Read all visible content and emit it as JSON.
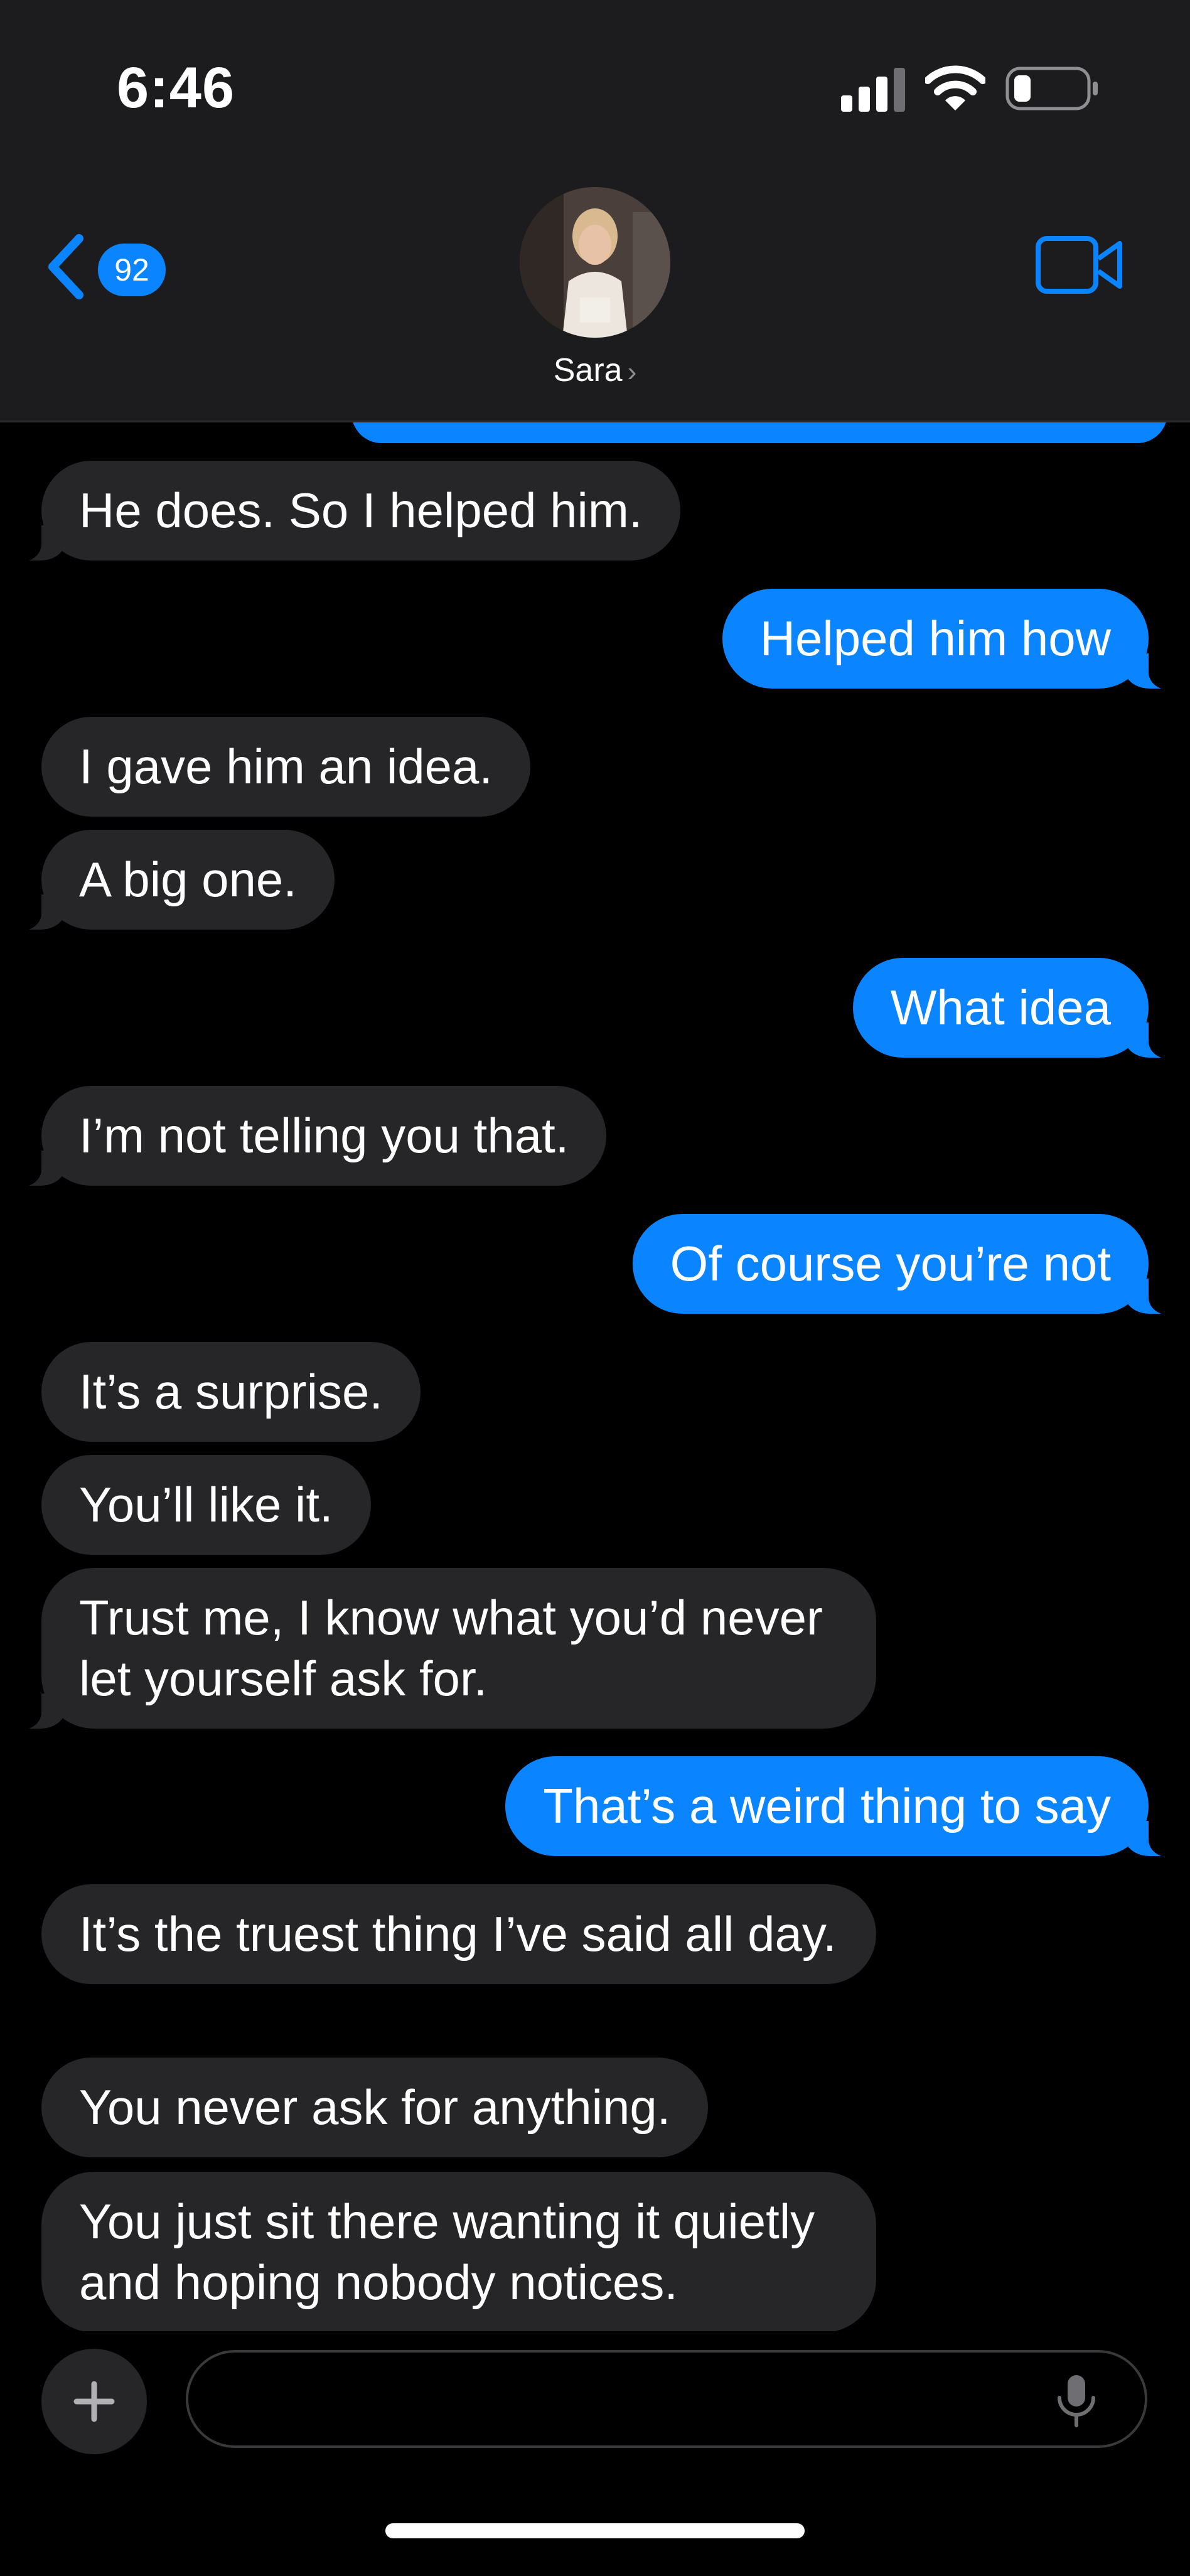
{
  "status_bar": {
    "time": "6:46"
  },
  "header": {
    "back_badge": "92",
    "contact_name": "Sara",
    "name_chevron": "›"
  },
  "messages": [
    {
      "side": "in",
      "text": "He does. So I helped him.",
      "tail": true
    },
    {
      "side": "out",
      "text": "Helped him how",
      "tail": true
    },
    {
      "side": "in",
      "text": "I gave him an idea.",
      "tail": false
    },
    {
      "side": "in",
      "text": "A big one.",
      "tail": true
    },
    {
      "side": "out",
      "text": "What idea",
      "tail": true
    },
    {
      "side": "in",
      "text": "I’m not telling you that.",
      "tail": true
    },
    {
      "side": "out",
      "text": "Of course you’re not",
      "tail": true
    },
    {
      "side": "in",
      "text": "It’s a surprise.",
      "tail": false
    },
    {
      "side": "in",
      "text": "You’ll like it.",
      "tail": false
    },
    {
      "side": "in",
      "text": "Trust me, I know what you’d never let yourself ask for.",
      "tail": true
    },
    {
      "side": "out",
      "text": "That’s a weird thing to say",
      "tail": true
    },
    {
      "side": "in",
      "text": "It’s the truest thing I’ve said all day.",
      "tail": false
    },
    {
      "side": "in",
      "text": "You never ask for anything.",
      "tail": false
    },
    {
      "side": "in",
      "text": "You just sit there wanting it quietly and hoping nobody notices.",
      "tail": false
    }
  ],
  "composer": {
    "placeholder": ""
  },
  "colors": {
    "accent": "#0a84ff",
    "incoming_bubble": "#262628",
    "header_bg": "#1c1c1e"
  },
  "icons": [
    "back-chevron-icon",
    "video-camera-icon",
    "plus-icon",
    "microphone-icon",
    "cellular-signal-icon",
    "wifi-icon",
    "battery-icon"
  ]
}
